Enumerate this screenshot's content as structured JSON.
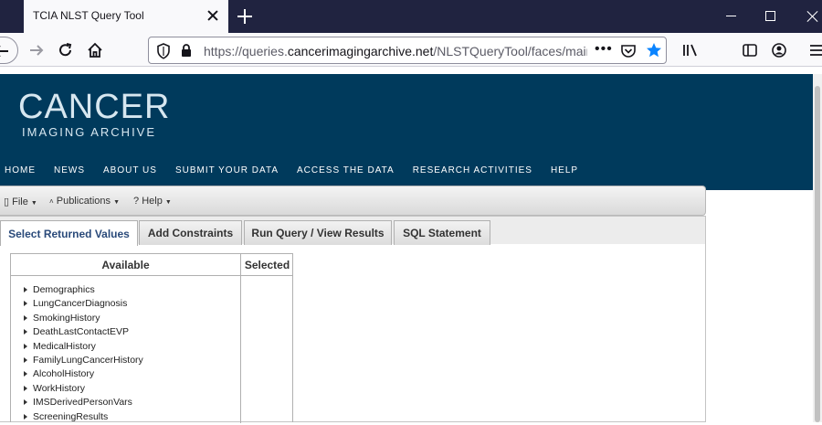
{
  "browser": {
    "tab_title": "TCIA NLST Query Tool",
    "url_prefix": "https://queries.",
    "url_domain": "cancerimagingarchive.net",
    "url_path": "/NLSTQueryTool/faces/main...",
    "page_actions": "•••"
  },
  "site": {
    "logo_main": "CANCER",
    "logo_sub": "IMAGING ARCHIVE",
    "nav": [
      "HOME",
      "NEWS",
      "ABOUT US",
      "SUBMIT YOUR DATA",
      "ACCESS THE DATA",
      "RESEARCH ACTIVITIES",
      "HELP"
    ]
  },
  "menubar": {
    "file": "File",
    "publications": "Publications",
    "help": "Help"
  },
  "tabs": [
    "Select Returned Values",
    "Add Constraints",
    "Run Query / View Results",
    "SQL Statement"
  ],
  "table": {
    "col_available": "Available",
    "col_selected": "Selected",
    "items": [
      "Demographics",
      "LungCancerDiagnosis",
      "SmokingHistory",
      "DeathLastContactEVP",
      "MedicalHistory",
      "FamilyLungCancerHistory",
      "AlcoholHistory",
      "WorkHistory",
      "IMSDerivedPersonVars",
      "ScreeningResults"
    ]
  },
  "colors": {
    "header_bg": "#003a5c",
    "tabstrip_bg": "#202340",
    "bookmark_star": "#0a84ff"
  }
}
